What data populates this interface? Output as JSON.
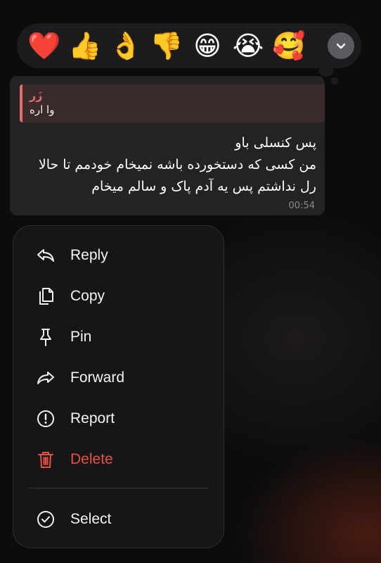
{
  "reactions": {
    "items": [
      {
        "emoji": "❤️",
        "name": "heart"
      },
      {
        "emoji": "👍",
        "name": "thumbs-up"
      },
      {
        "emoji": "👌",
        "name": "ok-hand"
      },
      {
        "emoji": "👎",
        "name": "thumbs-down"
      },
      {
        "emoji": "😁",
        "name": "grinning-face"
      },
      {
        "emoji": "😭",
        "name": "crying-face"
      },
      {
        "emoji": "🥰",
        "name": "smiling-face-hearts"
      }
    ],
    "expand_icon": "chevron-down-icon"
  },
  "message": {
    "reply": {
      "author": "زَر",
      "text": "وا اره"
    },
    "text": "پس کنسلی باو\nمن کسی که دستخورده باشه نمیخام خودمم تا حالا رل نداشتم پس یه آدم پاک و سالم میخام",
    "time": "00:54",
    "colors": {
      "bubble": "#232326",
      "quote_accent": "#e46b6b"
    }
  },
  "menu": {
    "items": [
      {
        "label": "Reply",
        "icon": "reply-icon"
      },
      {
        "label": "Copy",
        "icon": "copy-icon"
      },
      {
        "label": "Pin",
        "icon": "pin-icon"
      },
      {
        "label": "Forward",
        "icon": "forward-icon"
      },
      {
        "label": "Report",
        "icon": "report-icon"
      },
      {
        "label": "Delete",
        "icon": "trash-icon",
        "color": "#e5533f"
      }
    ],
    "select": {
      "label": "Select",
      "icon": "select-check-icon"
    }
  }
}
